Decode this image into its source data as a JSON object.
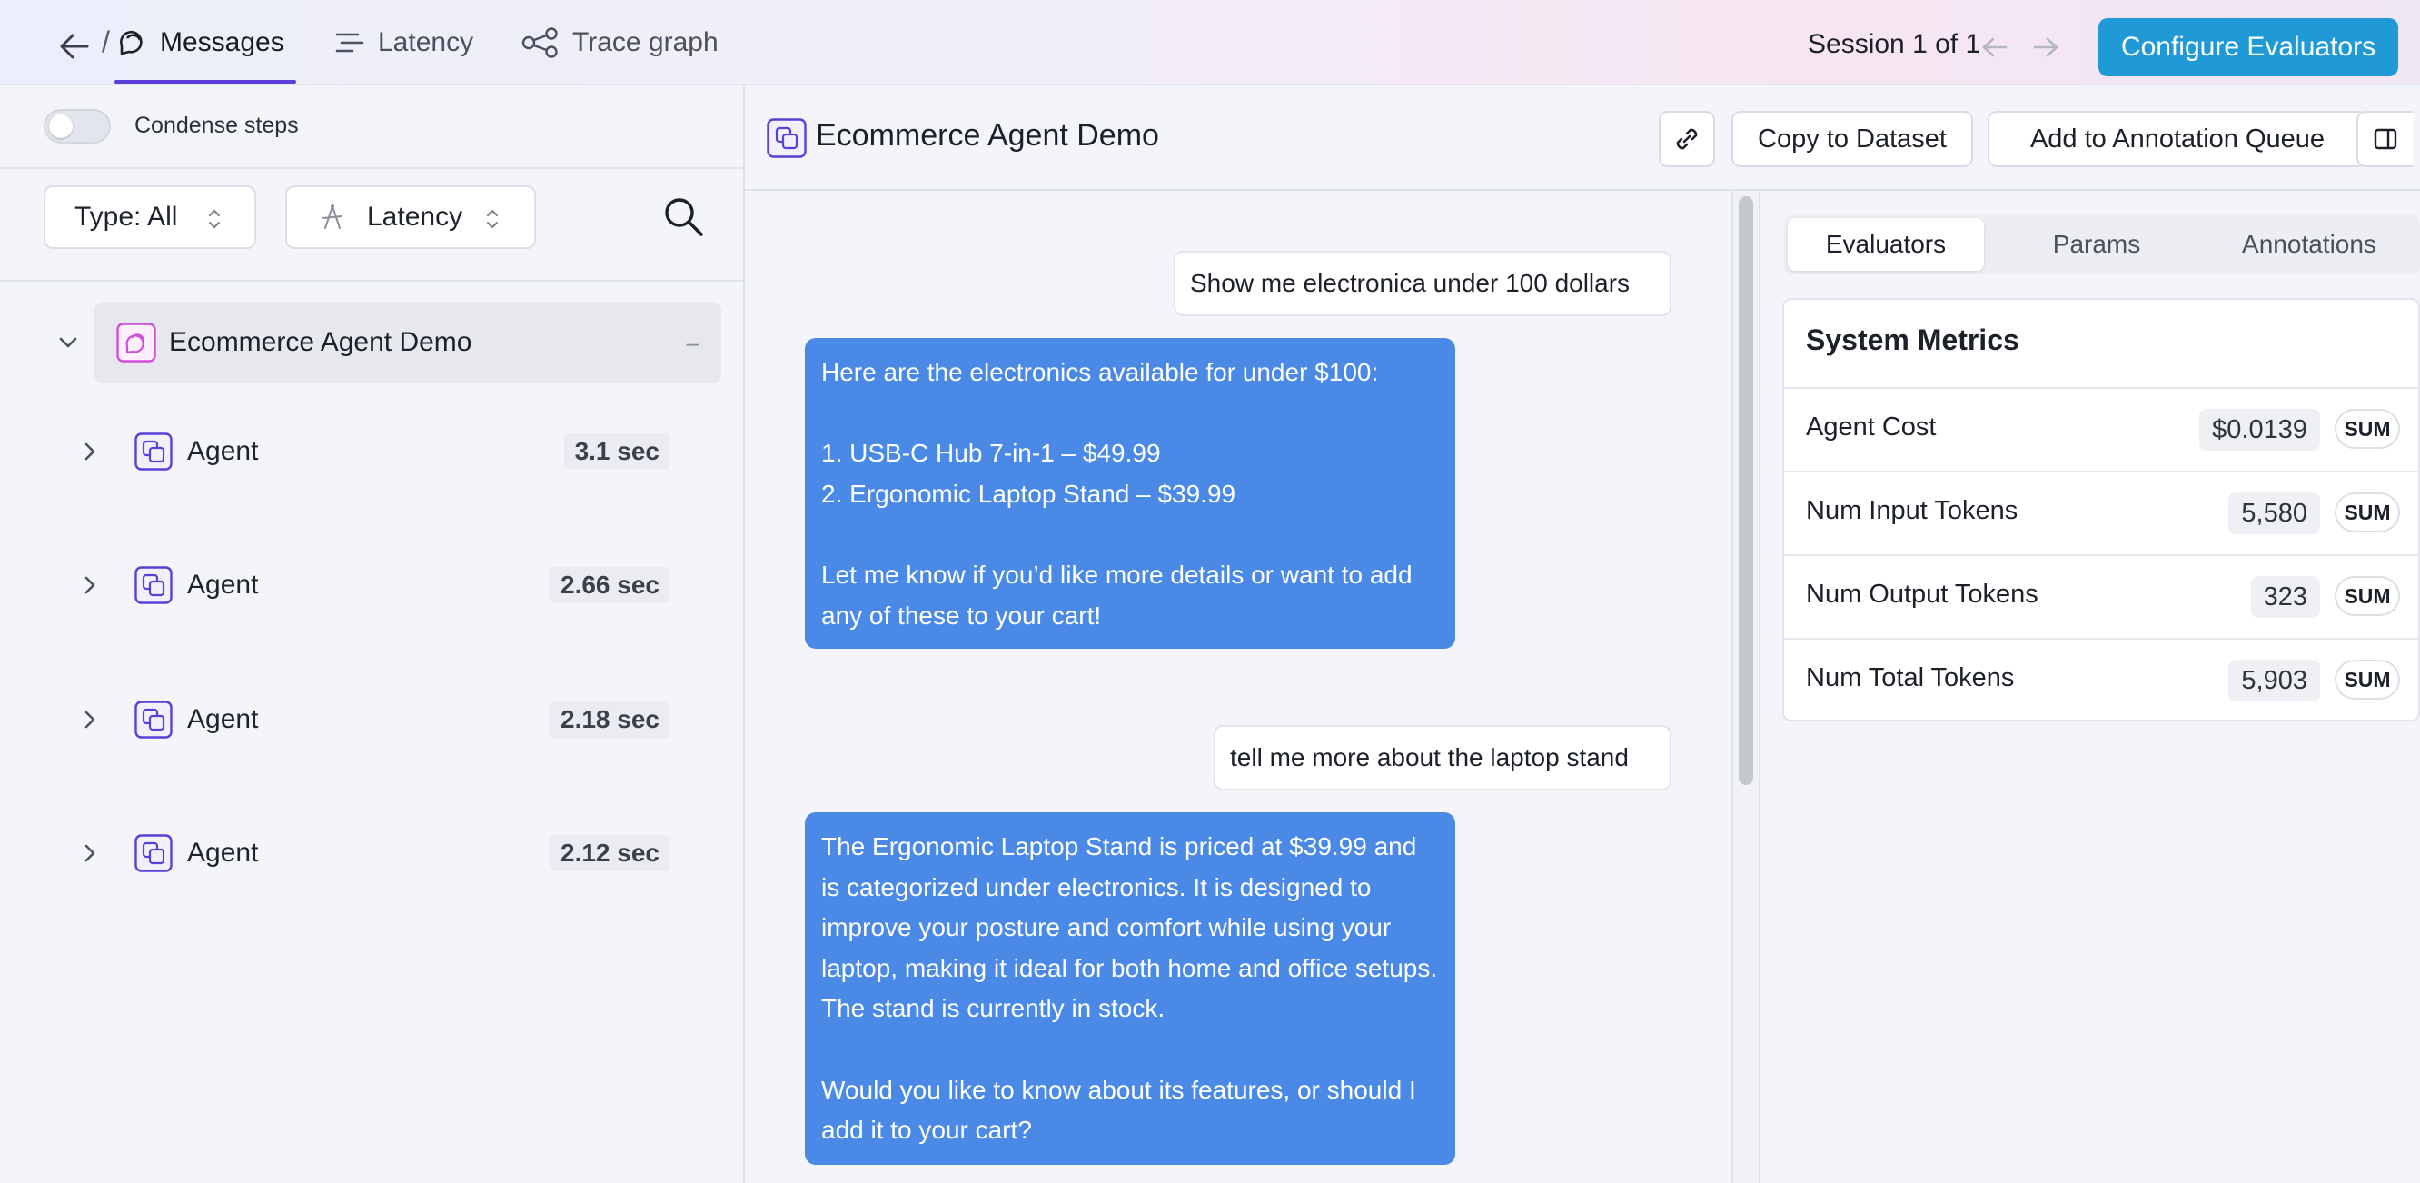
{
  "nav": {
    "tabs": [
      {
        "label": "Messages",
        "icon": "chat-icon"
      },
      {
        "label": "Latency",
        "icon": "latency-icon"
      },
      {
        "label": "Trace graph",
        "icon": "graph-icon"
      }
    ],
    "separator": "/",
    "session": "Session 1 of 1",
    "configure_label": "Configure Evaluators"
  },
  "left": {
    "condense_label": "Condense steps",
    "type_filter": "Type: All",
    "sort_filter": "Latency",
    "root": {
      "name": "Ecommerce Agent Demo",
      "collapse": "–"
    },
    "items": [
      {
        "name": "Agent",
        "duration": "3.1 sec"
      },
      {
        "name": "Agent",
        "duration": "2.66 sec"
      },
      {
        "name": "Agent",
        "duration": "2.18 sec"
      },
      {
        "name": "Agent",
        "duration": "2.12 sec"
      }
    ]
  },
  "center": {
    "title": "Ecommerce Agent Demo",
    "copy_label": "Copy to Dataset",
    "annotate_label": "Add to Annotation Queue",
    "messages": [
      {
        "role": "user",
        "text": "Show me electronica under 100 dollars"
      },
      {
        "role": "assistant",
        "text": "Here are the electronics available for under $100:\n\n1. USB-C Hub 7-in-1 – $49.99\n2. Ergonomic Laptop Stand – $39.99\n\nLet me know if you’d like more details or want to add any of these to your cart!"
      },
      {
        "role": "user",
        "text": "tell me more about the laptop stand"
      },
      {
        "role": "assistant",
        "text": "The Ergonomic Laptop Stand is priced at $39.99 and is categorized under electronics. It is designed to improve your posture and comfort while using your laptop, making it ideal for both home and office setups. The stand is currently in stock.\n\nWould you like to know about its features, or should I add it to your cart?"
      }
    ]
  },
  "right": {
    "tabs": [
      "Evaluators",
      "Params",
      "Annotations"
    ],
    "metrics_title": "System Metrics",
    "metrics": [
      {
        "label": "Agent Cost",
        "value": "$0.0139",
        "agg": "SUM"
      },
      {
        "label": "Num Input Tokens",
        "value": "5,580",
        "agg": "SUM"
      },
      {
        "label": "Num Output Tokens",
        "value": "323",
        "agg": "SUM"
      },
      {
        "label": "Num Total Tokens",
        "value": "5,903",
        "agg": "SUM"
      }
    ]
  },
  "colors": {
    "accent": "#5b3fd6",
    "primary_button": "#1f9ad6",
    "assistant_bubble": "#4a8ae6",
    "root_icon": "#d24fd9"
  }
}
